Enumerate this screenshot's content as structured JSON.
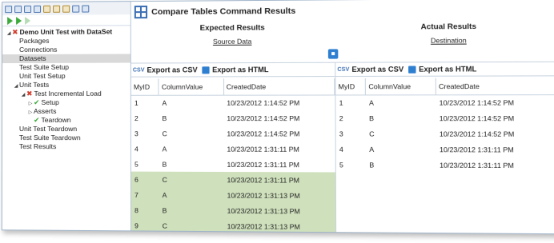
{
  "window": {
    "title": "Compare Tables Command Results"
  },
  "tree": [
    {
      "label": "Demo Unit Test with DataSet",
      "indent": 0,
      "icon": "x-mark-icon",
      "twisty": "expanded",
      "bold": true
    },
    {
      "label": "Packages",
      "indent": 1
    },
    {
      "label": "Connections",
      "indent": 1
    },
    {
      "label": "Datasets",
      "indent": 1,
      "selected": true
    },
    {
      "label": "Test Suite Setup",
      "indent": 1
    },
    {
      "label": "Unit Test Setup",
      "indent": 1
    },
    {
      "label": "Unit Tests",
      "indent": 1,
      "twisty": "expanded"
    },
    {
      "label": "Test Incremental Load",
      "indent": 2,
      "icon": "x-mark-icon",
      "twisty": "expanded"
    },
    {
      "label": "Setup",
      "indent": 3,
      "icon": "check-icon",
      "twisty": "collapsed"
    },
    {
      "label": "Asserts",
      "indent": 3,
      "twisty": "collapsed"
    },
    {
      "label": "Teardown",
      "indent": 3,
      "icon": "check-icon"
    },
    {
      "label": "Unit Test Teardown",
      "indent": 1
    },
    {
      "label": "Test Suite Teardown",
      "indent": 1
    },
    {
      "label": "Test Results",
      "indent": 1
    }
  ],
  "expected": {
    "heading": "Expected Results",
    "source_link": "Source Data",
    "export_csv": "Export as CSV",
    "export_html": "Export as HTML",
    "columns": [
      "MyID",
      "ColumnValue",
      "CreatedDate"
    ],
    "rows": [
      {
        "id": "1",
        "value": "A",
        "date": "10/23/2012 1:14:52 PM",
        "highlight": false
      },
      {
        "id": "2",
        "value": "B",
        "date": "10/23/2012 1:14:52 PM",
        "highlight": false
      },
      {
        "id": "3",
        "value": "C",
        "date": "10/23/2012 1:14:52 PM",
        "highlight": false
      },
      {
        "id": "4",
        "value": "A",
        "date": "10/23/2012 1:31:11 PM",
        "highlight": false
      },
      {
        "id": "5",
        "value": "B",
        "date": "10/23/2012 1:31:11 PM",
        "highlight": false
      },
      {
        "id": "6",
        "value": "C",
        "date": "10/23/2012 1:31:11 PM",
        "highlight": true
      },
      {
        "id": "7",
        "value": "A",
        "date": "10/23/2012 1:31:13 PM",
        "highlight": true
      },
      {
        "id": "8",
        "value": "B",
        "date": "10/23/2012 1:31:13 PM",
        "highlight": true
      },
      {
        "id": "9",
        "value": "C",
        "date": "10/23/2012 1:31:13 PM",
        "highlight": true
      }
    ]
  },
  "actual": {
    "heading": "Actual Results",
    "destination_link": "Destination",
    "export_csv": "Export as CSV",
    "export_html": "Export as HTML",
    "columns": [
      "MyID",
      "ColumnValue",
      "CreatedDate"
    ],
    "rows": [
      {
        "id": "1",
        "value": "A",
        "date": "10/23/2012 1:14:52 PM"
      },
      {
        "id": "2",
        "value": "B",
        "date": "10/23/2012 1:14:52 PM"
      },
      {
        "id": "3",
        "value": "C",
        "date": "10/23/2012 1:14:52 PM"
      },
      {
        "id": "4",
        "value": "A",
        "date": "10/23/2012 1:31:11 PM"
      },
      {
        "id": "5",
        "value": "B",
        "date": "10/23/2012 1:31:11 PM"
      }
    ]
  },
  "colors": {
    "mismatch_highlight": "#cfe0bc",
    "error": "#d03b2b",
    "success": "#3daa3d",
    "accent": "#3c6fb4"
  }
}
